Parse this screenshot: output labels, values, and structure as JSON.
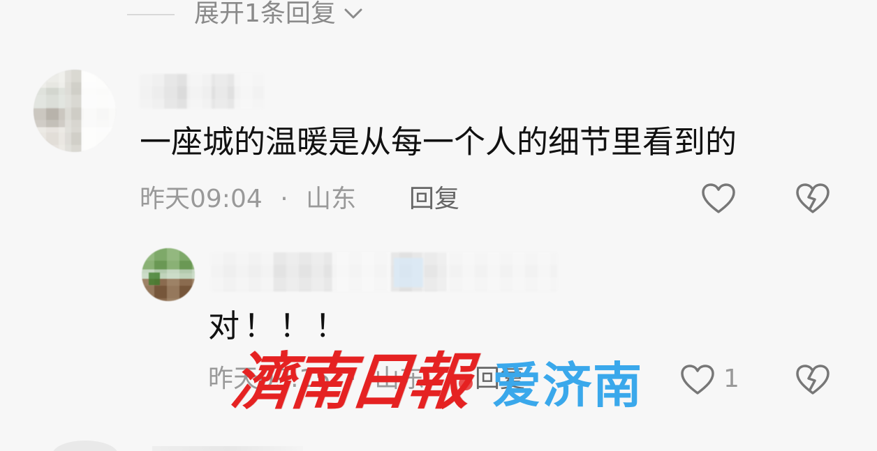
{
  "replies_toggle": {
    "label": "展开1条回复",
    "icon": "chevron-down-icon"
  },
  "comments": [
    {
      "text": "一座城的温暖是从每一个人的细节里看到的",
      "time": "昨天09:04",
      "separator": "·",
      "location": "山东",
      "reply_label": "回复",
      "like_icon": "heart-outline-icon",
      "dislike_icon": "broken-heart-icon"
    },
    {
      "text": "对！！！",
      "time": "昨天09:15",
      "separator": "·",
      "location": "山东",
      "reply_label": "回复",
      "like_icon": "heart-outline-icon",
      "like_count": "1",
      "dislike_icon": "broken-heart-icon"
    }
  ],
  "watermark": {
    "red_text": "濟南日報",
    "blue_text": "爱济南",
    "red_color": "#e52222",
    "blue_color": "#3aa8eb"
  }
}
